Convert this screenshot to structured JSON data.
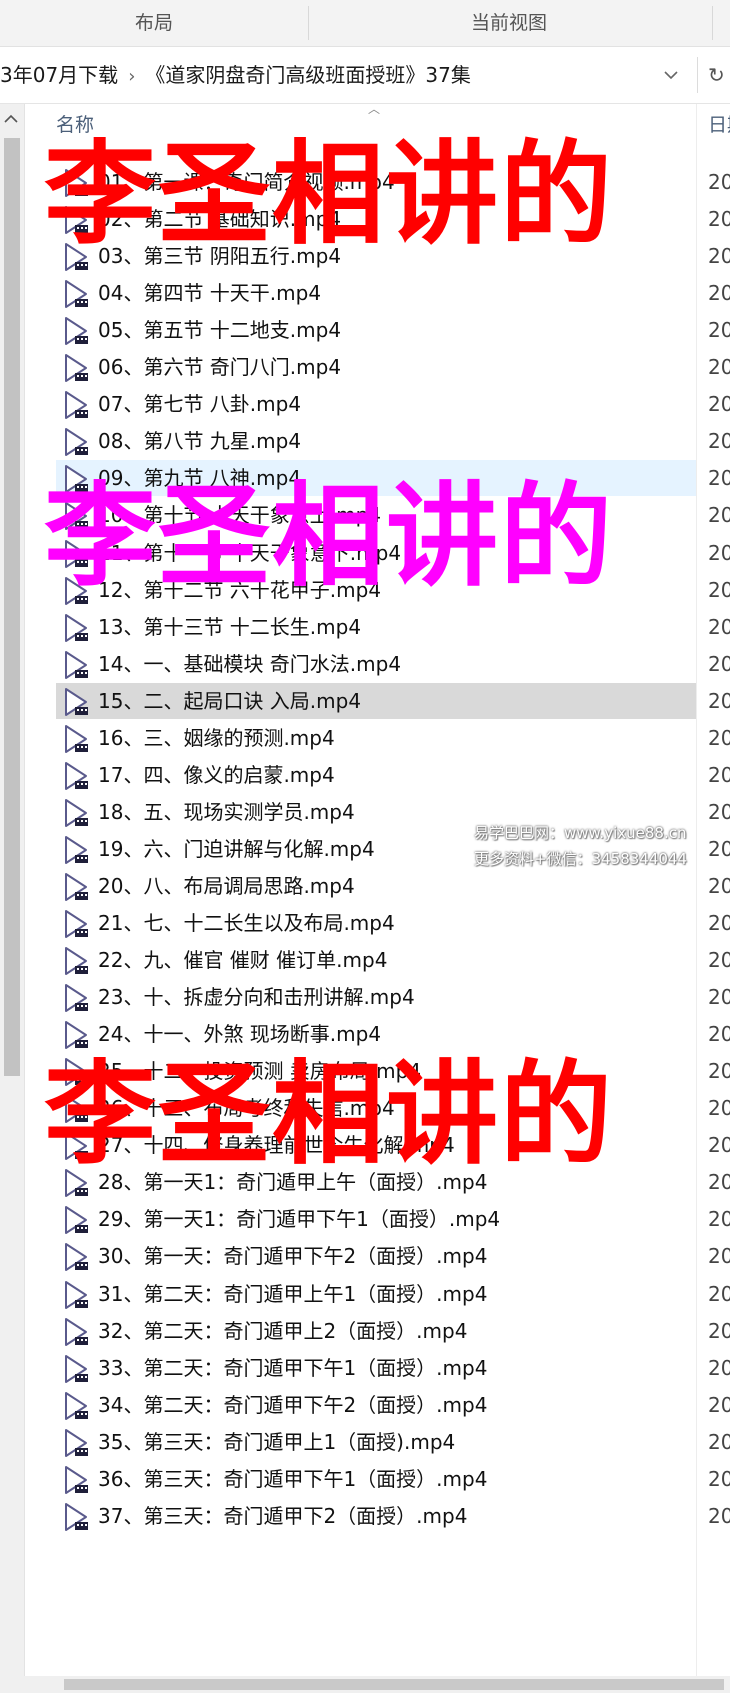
{
  "ribbon": {
    "group_layout": "布局",
    "group_current_view": "当前视图"
  },
  "address": {
    "crumb_prev": "3年07月下载",
    "crumb_current": "《道家阴盘奇门高级班面授班》37集",
    "dropdown_icon": "chevron-down-icon",
    "refresh_icon": "refresh-icon"
  },
  "columns": {
    "name": "名称",
    "date": "日期"
  },
  "files": [
    {
      "name": "01、第一课：奇门简介视频.mp4",
      "date": "20"
    },
    {
      "name": "02、第二节 基础知识.mp4",
      "date": "20"
    },
    {
      "name": "03、第三节 阴阳五行.mp4",
      "date": "20"
    },
    {
      "name": "04、第四节 十天干.mp4",
      "date": "20"
    },
    {
      "name": "05、第五节 十二地支.mp4",
      "date": "20"
    },
    {
      "name": "06、第六节  奇门八门.mp4",
      "date": "20"
    },
    {
      "name": "07、第七节 八卦.mp4",
      "date": "20"
    },
    {
      "name": "08、第八节  九星.mp4",
      "date": "20"
    },
    {
      "name": "09、第九节  八神.mp4",
      "date": "20"
    },
    {
      "name": "10、第十节 十天干象意上.mp4",
      "date": "20"
    },
    {
      "name": "11、第十一节 十天干象意下.mp4",
      "date": "20"
    },
    {
      "name": "12、第十二节 六十花甲子.mp4",
      "date": "20"
    },
    {
      "name": "13、第十三节 十二长生.mp4",
      "date": "20"
    },
    {
      "name": "14、一、基础模块 奇门水法.mp4",
      "date": "20"
    },
    {
      "name": "15、二、起局口诀 入局.mp4",
      "date": "20"
    },
    {
      "name": "16、三、姻缘的预测.mp4",
      "date": "20"
    },
    {
      "name": "17、四、像义的启蒙.mp4",
      "date": "20"
    },
    {
      "name": "18、五、现场实测学员.mp4",
      "date": "20"
    },
    {
      "name": "19、六、门迫讲解与化解.mp4",
      "date": "20"
    },
    {
      "name": "20、八、布局调局思路.mp4",
      "date": "20"
    },
    {
      "name": "21、七、十二长生以及布局.mp4",
      "date": "20"
    },
    {
      "name": "22、九、催官 催财 催订单.mp4",
      "date": "20"
    },
    {
      "name": "23、十、拆虚分向和击刑讲解.mp4",
      "date": "20"
    },
    {
      "name": "24、十一、外煞 现场断事.mp4",
      "date": "20"
    },
    {
      "name": "25、十二、投资预测 卖房布局.mp4",
      "date": "20"
    },
    {
      "name": "26、十三、布局考终和失信.mp4",
      "date": "20"
    },
    {
      "name": "27、十四、修身养理前世今生化解.mp4",
      "date": "20"
    },
    {
      "name": "28、第一天1：奇门遁甲上午（面授）.mp4",
      "date": "20"
    },
    {
      "name": "29、第一天1：奇门遁甲下午1（面授）.mp4",
      "date": "20"
    },
    {
      "name": "30、第一天：奇门遁甲下午2（面授）.mp4",
      "date": "20"
    },
    {
      "name": "31、第二天：奇门遁甲上午1（面授）.mp4",
      "date": "20"
    },
    {
      "name": "32、第二天：奇门遁甲上2（面授）.mp4",
      "date": "20"
    },
    {
      "name": "33、第二天：奇门遁甲下午1（面授）.mp4",
      "date": "20"
    },
    {
      "name": "34、第二天：奇门遁甲下午2（面授）.mp4",
      "date": "20"
    },
    {
      "name": "35、第三天：奇门遁甲上1（面授).mp4",
      "date": "20"
    },
    {
      "name": "36、第三天：奇门遁甲下午1（面授）.mp4",
      "date": "20"
    },
    {
      "name": "37、第三天：奇门遁甲下2（面授）.mp4",
      "date": "20"
    }
  ],
  "hover_index": 8,
  "selected_index": 14,
  "watermarks": {
    "big_text": "李圣相讲的",
    "site_line": "易学巴巴网：www.yixue88.cn",
    "contact_line": "更多资料+微信：3458344044"
  },
  "colors": {
    "wm_red": "#ff0000",
    "wm_magenta": "#ff00ff",
    "hover": "#e5f3ff",
    "selected": "#d9d9d9"
  }
}
